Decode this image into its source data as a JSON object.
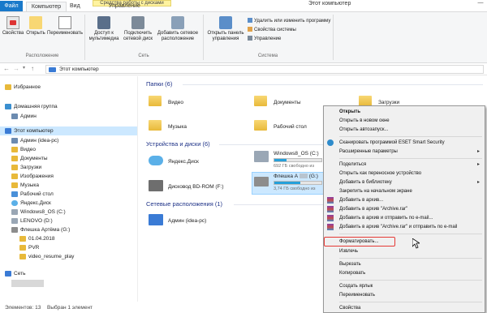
{
  "ribbon_tabs": {
    "file": "Файл",
    "computer": "Компьютер",
    "view": "Вид",
    "manage": "Управление",
    "context": "Средства работы с дисками"
  },
  "window_title": "Этот компьютер",
  "ribbon": {
    "properties": "Свойства",
    "open": "Открыть",
    "rename": "Переименовать",
    "group_location": "Расположение",
    "media_access": "Доступ к мультимедиа",
    "map_drive": "Подключить сетевой диск",
    "add_location": "Добавить сетевое расположение",
    "group_network": "Сеть",
    "open_cp": "Открыть панель управления",
    "uninstall": "Удалить или изменить программу",
    "sys_props": "Свойства системы",
    "manage": "Управление",
    "group_system": "Система"
  },
  "address": {
    "path": "Этот компьютер"
  },
  "nav": {
    "favorites": "Избранное",
    "homegroup": "Домашняя группа",
    "admin": "Админ",
    "this_pc": "Этот компьютер",
    "admin_pc": "Админ (idea-pc)",
    "video": "Видео",
    "documents": "Документы",
    "downloads": "Загрузки",
    "images": "Изображения",
    "music": "Музыка",
    "desktop": "Рабочий стол",
    "yandex": "Яндекс.Диск",
    "win8": "Windows8_OS (C:)",
    "lenovo": "LENOVO (D:)",
    "flash": "Флешка Артёма (G:)",
    "f1": "01.04.2018",
    "f2": "PVR",
    "f3": "video_resume_play",
    "network": "Сеть"
  },
  "content": {
    "folders_hdr": "Папки (6)",
    "f_video": "Видео",
    "f_docs": "Документы",
    "f_down": "Загрузки",
    "f_music": "Музыка",
    "f_desk": "Рабочий стол",
    "devices_hdr": "Устройства и диски (6)",
    "d_yandex": "Яндекс.Диск",
    "d_win8": "Windows8_OS (C:)",
    "d_win8_free": "692 ГБ свободно из",
    "d_bd": "Дисковод BD-ROM (F:)",
    "d_flash": "Флешка А",
    "d_flash_tail": "(G:)",
    "d_flash_free": "3,74 ГБ свободно из",
    "net_hdr": "Сетевые расположения (1)",
    "n_admin": "Админ (idea-pc)"
  },
  "drives": {
    "win8_fill": 0.25,
    "flash_fill": 0.55
  },
  "status": {
    "count": "Элементов: 13",
    "selected": "Выбран 1 элемент"
  },
  "menu": {
    "open": "Открыть",
    "open_new": "Открыть в новом окне",
    "autorun": "Открыть автозапуск...",
    "eset": "Сканировать программой ESET Smart Security",
    "advanced": "Расширенные параметры",
    "share": "Поделиться",
    "portable": "Открыть как переносное устройство",
    "library": "Добавить в библиотеку",
    "pin": "Закрепить на начальном экране",
    "archive": "Добавить в архив...",
    "archive_rar": "Добавить в архив \"Archive.rar\"",
    "archive_email": "Добавить в архив и отправить по e-mail...",
    "archive_rar_email": "Добавить в архив \"Archive.rar\" и отправить по e-mail",
    "format": "Форматировать...",
    "eject": "Извлечь",
    "cut": "Вырезать",
    "copy": "Копировать",
    "shortcut": "Создать ярлык",
    "rename": "Переименовать",
    "properties": "Свойства"
  },
  "colors": {
    "accent": "#1979ca",
    "highlight": "#e53935",
    "selection": "#cce8ff"
  }
}
